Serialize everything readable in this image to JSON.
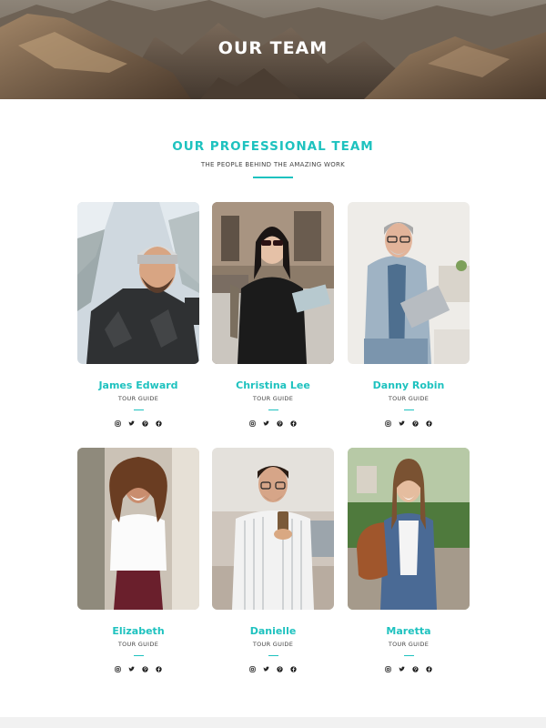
{
  "hero": {
    "title": "OUR TEAM"
  },
  "section": {
    "title": "OUR PROFESSIONAL TEAM",
    "subtitle": "THE PEOPLE BEHIND THE AMAZING WORK"
  },
  "team": [
    {
      "name": "James Edward",
      "role": "TOUR GUIDE"
    },
    {
      "name": "Christina Lee",
      "role": "TOUR GUIDE"
    },
    {
      "name": "Danny Robin",
      "role": "TOUR GUIDE"
    },
    {
      "name": "Elizabeth",
      "role": "TOUR GUIDE"
    },
    {
      "name": "Danielle",
      "role": "TOUR GUIDE"
    },
    {
      "name": "Maretta",
      "role": "TOUR GUIDE"
    }
  ],
  "social_icons": [
    "instagram-icon",
    "twitter-icon",
    "pinterest-icon",
    "facebook-icon"
  ],
  "colors": {
    "accent": "#1ec2bf",
    "text": "#444444",
    "background": "#ffffff"
  }
}
